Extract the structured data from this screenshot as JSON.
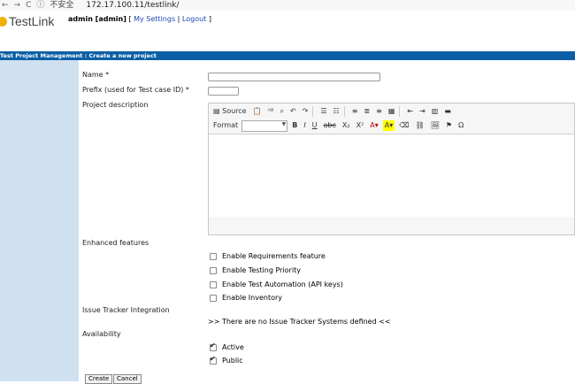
{
  "browser": {
    "insecure_label": "不安全",
    "url": "172.17.100.11/testlink/"
  },
  "header": {
    "logo_text": "TestLink",
    "user": "admin [admin]",
    "open_bracket": "[",
    "my_settings": "My Settings",
    "separator": "|",
    "logout": "Logout",
    "close_bracket": "]"
  },
  "page": {
    "title": "Test Project Management : Create a new project"
  },
  "form": {
    "name_label": "Name *",
    "name_value": "",
    "prefix_label": "Prefix (used for Test case ID) *",
    "prefix_value": "",
    "description_label": "Project description",
    "enhanced_label": "Enhanced features",
    "features": [
      {
        "label": "Enable Requirements feature",
        "checked": false
      },
      {
        "label": "Enable Testing Priority",
        "checked": false
      },
      {
        "label": "Enable Test Automation (API keys)",
        "checked": false
      },
      {
        "label": "Enable Inventory",
        "checked": false
      }
    ],
    "issue_tracker_label": "Issue Tracker Integration",
    "issue_tracker_message": ">> There are no Issue Tracker Systems defined <<",
    "availability_label": "Availability",
    "availability": [
      {
        "label": "Active",
        "checked": true
      },
      {
        "label": "Public",
        "checked": true
      }
    ],
    "create_button": "Create",
    "cancel_button": "Cancel"
  },
  "editor": {
    "source_label": "Source",
    "format_label": "Format"
  }
}
